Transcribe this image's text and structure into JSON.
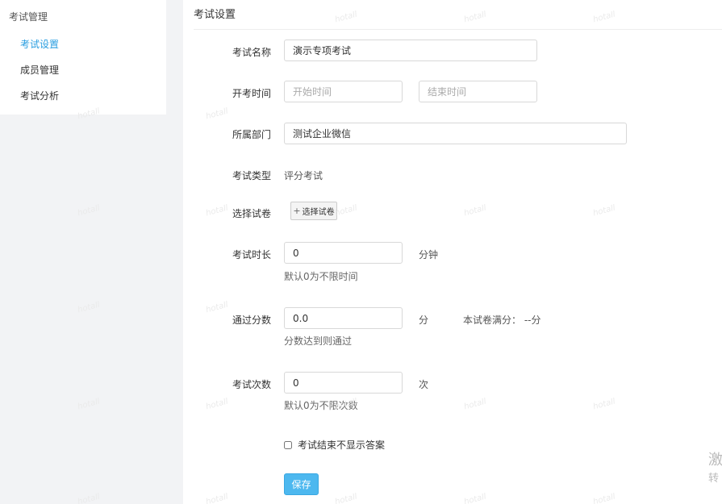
{
  "sidebar": {
    "group_title": "考试管理",
    "items": [
      {
        "label": "考试设置",
        "active": true
      },
      {
        "label": "成员管理",
        "active": false
      },
      {
        "label": "考试分析",
        "active": false
      }
    ]
  },
  "main": {
    "section_title": "考试设置",
    "form": {
      "exam_name": {
        "label": "考试名称",
        "value": "演示专项考试"
      },
      "exam_time": {
        "label": "开考时间",
        "start_placeholder": "开始时间",
        "end_placeholder": "结束时间"
      },
      "department": {
        "label": "所属部门",
        "value": "测试企业微信"
      },
      "exam_type": {
        "label": "考试类型",
        "value": "评分考试"
      },
      "paper": {
        "label": "选择试卷",
        "button_label": "选择试卷",
        "button_icon": "plus-icon"
      },
      "duration": {
        "label": "考试时长",
        "value": "0",
        "unit": "分钟",
        "hint": "默认0为不限时间"
      },
      "pass_score": {
        "label": "通过分数",
        "value": "0.0",
        "unit": "分",
        "full_score_text": "本试卷满分：  --分",
        "hint": "分数达到则通过"
      },
      "attempts": {
        "label": "考试次数",
        "value": "0",
        "unit": "次",
        "hint": "默认0为不限次数"
      },
      "hide_answers": {
        "label": "考试结束不显示答案",
        "checked": false
      },
      "save_label": "保存"
    }
  },
  "watermark_text": "hotall",
  "edge_text": {
    "line1": "激",
    "line2": "转"
  },
  "colors": {
    "accent": "#2a9ee0",
    "primary_button": "#4db8ef",
    "page_bg": "#f2f3f5"
  }
}
